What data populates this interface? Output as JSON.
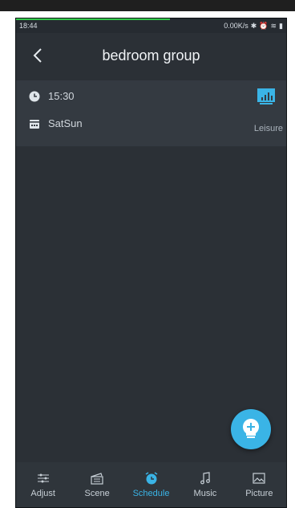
{
  "status_bar": {
    "time": "18:44",
    "net_speed": "0.00K/s"
  },
  "header": {
    "title": "bedroom group"
  },
  "schedule": {
    "time": "15:30",
    "days": "SatSun",
    "scene": "Leisure"
  },
  "tabs": [
    {
      "label": "Adjust"
    },
    {
      "label": "Scene"
    },
    {
      "label": "Schedule"
    },
    {
      "label": "Music"
    },
    {
      "label": "Picture"
    }
  ],
  "colors": {
    "accent": "#3ab4e6",
    "background": "#2b3036",
    "card": "#343a41"
  },
  "active_tab": "Schedule"
}
